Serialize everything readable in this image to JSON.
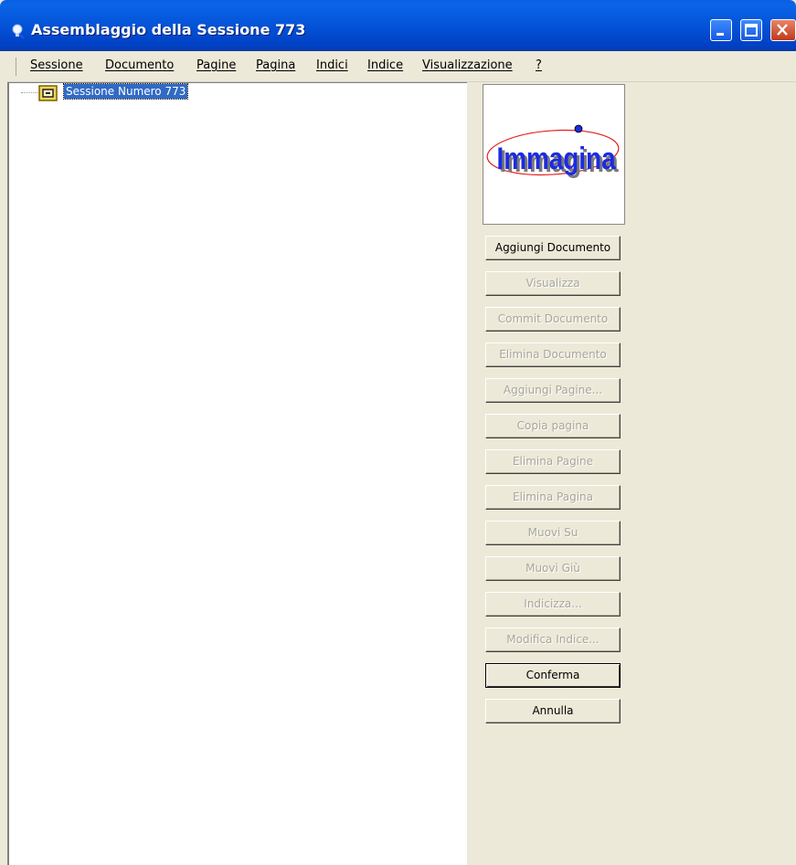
{
  "window": {
    "title": "Assemblaggio della Sessione 773",
    "icon": "app-bulb-icon",
    "controls": [
      "minimize-icon",
      "maximize-icon",
      "close-icon"
    ]
  },
  "menu": {
    "items": [
      {
        "label": "Sessione"
      },
      {
        "label": "Documento"
      },
      {
        "label": "Pagine"
      },
      {
        "label": "Pagina"
      },
      {
        "label": "Indici"
      },
      {
        "label": "Indice"
      },
      {
        "label": "Visualizzazione"
      },
      {
        "label": "?"
      }
    ]
  },
  "tree": {
    "root": {
      "label": "Sessione Numero 773",
      "icon": "session-folder-icon",
      "selected": true
    }
  },
  "logo": {
    "text": "Immagina",
    "color": "#1c2be0"
  },
  "buttons": [
    {
      "label": "Aggiungi Documento",
      "enabled": true
    },
    {
      "label": "Visualizza",
      "enabled": false
    },
    {
      "label": "Commit Documento",
      "enabled": false
    },
    {
      "label": "Elimina Documento",
      "enabled": false
    },
    {
      "label": "Aggiungi Pagine...",
      "enabled": false
    },
    {
      "label": "Copia pagina",
      "enabled": false
    },
    {
      "label": "Elimina Pagine",
      "enabled": false
    },
    {
      "label": "Elimina Pagina",
      "enabled": false
    },
    {
      "label": "Muovi Su",
      "enabled": false
    },
    {
      "label": "Muovi Giù",
      "enabled": false
    },
    {
      "label": "Indicizza...",
      "enabled": false
    },
    {
      "label": "Modifica Indice...",
      "enabled": false
    },
    {
      "label": "Conferma",
      "enabled": true,
      "default": true
    },
    {
      "label": "Annulla",
      "enabled": true
    }
  ]
}
